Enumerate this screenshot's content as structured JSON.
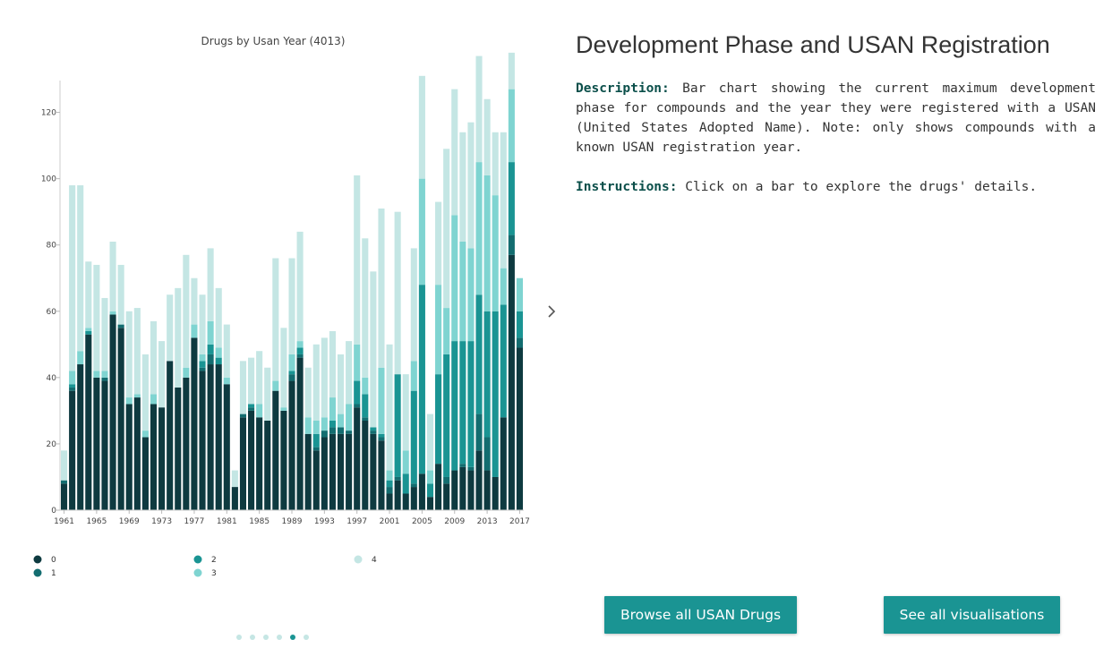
{
  "chart_data": {
    "type": "bar",
    "stacked": true,
    "title": "Drugs by Usan Year (4013)",
    "xlabel": "",
    "ylabel": "",
    "ylim": [
      0,
      135
    ],
    "yticks": [
      0,
      20,
      40,
      60,
      80,
      100,
      120
    ],
    "xtick_labels": [
      "1961",
      "1965",
      "1969",
      "1973",
      "1977",
      "1981",
      "1985",
      "1989",
      "1993",
      "1997",
      "2001",
      "2005",
      "2009",
      "2013",
      "2017"
    ],
    "legend_position": "bottom",
    "categories": [
      "1961",
      "1962",
      "1963",
      "1964",
      "1965",
      "1966",
      "1967",
      "1968",
      "1969",
      "1970",
      "1971",
      "1972",
      "1973",
      "1974",
      "1975",
      "1976",
      "1977",
      "1978",
      "1979",
      "1980",
      "1981",
      "1982",
      "1983",
      "1984",
      "1985",
      "1986",
      "1987",
      "1988",
      "1989",
      "1990",
      "1991",
      "1992",
      "1993",
      "1994",
      "1995",
      "1996",
      "1997",
      "1998",
      "1999",
      "2000",
      "2001",
      "2002",
      "2003",
      "2004",
      "2005",
      "2006",
      "2007",
      "2008",
      "2009",
      "2010",
      "2011",
      "2012",
      "2013",
      "2014",
      "2015",
      "2016",
      "2017"
    ],
    "series": [
      {
        "name": "0",
        "color": "#0e3a40",
        "values": [
          8,
          36,
          44,
          53,
          40,
          39,
          59,
          55,
          32,
          34,
          22,
          32,
          31,
          45,
          37,
          40,
          52,
          42,
          44,
          44,
          38,
          7,
          28,
          30,
          28,
          27,
          36,
          30,
          39,
          46,
          23,
          18,
          22,
          23,
          23,
          23,
          31,
          27,
          23,
          21,
          5,
          9,
          5,
          7,
          11,
          4,
          14,
          8,
          12,
          13,
          12,
          18,
          12,
          10,
          28,
          77,
          49
        ]
      },
      {
        "name": "1",
        "color": "#136d70",
        "values": [
          1,
          1,
          0,
          0,
          0,
          1,
          0,
          1,
          0,
          0,
          0,
          0,
          0,
          0,
          0,
          0,
          0,
          1,
          3,
          0,
          0,
          0,
          1,
          1,
          0,
          0,
          0,
          0,
          2,
          1,
          0,
          1,
          2,
          2,
          2,
          1,
          1,
          1,
          1,
          1,
          2,
          1,
          0,
          1,
          0,
          0,
          0,
          2,
          0,
          1,
          1,
          11,
          10,
          0,
          0,
          6,
          3
        ]
      },
      {
        "name": "2",
        "color": "#1a9493",
        "values": [
          0,
          1,
          0,
          1,
          0,
          0,
          0,
          0,
          0,
          0,
          0,
          0,
          0,
          0,
          0,
          0,
          0,
          2,
          3,
          2,
          0,
          0,
          0,
          1,
          0,
          0,
          0,
          0,
          1,
          2,
          0,
          4,
          0,
          2,
          0,
          0,
          7,
          7,
          1,
          1,
          2,
          31,
          6,
          28,
          57,
          4,
          27,
          37,
          39,
          37,
          38,
          36,
          38,
          50,
          34,
          22,
          8
        ]
      },
      {
        "name": "3",
        "color": "#7fd4d1",
        "values": [
          0,
          4,
          4,
          1,
          2,
          2,
          1,
          0,
          2,
          1,
          2,
          3,
          0,
          0,
          0,
          3,
          4,
          2,
          7,
          3,
          2,
          0,
          0,
          0,
          4,
          0,
          3,
          1,
          5,
          2,
          5,
          4,
          4,
          7,
          4,
          8,
          11,
          5,
          0,
          20,
          3,
          0,
          7,
          9,
          32,
          4,
          27,
          14,
          38,
          30,
          28,
          40,
          41,
          35,
          11,
          22,
          10
        ]
      },
      {
        "name": "4",
        "color": "#c4e6e4",
        "values": [
          9,
          56,
          50,
          20,
          32,
          22,
          21,
          18,
          26,
          26,
          23,
          22,
          20,
          20,
          30,
          34,
          14,
          18,
          22,
          18,
          16,
          5,
          16,
          14,
          16,
          16,
          37,
          24,
          29,
          33,
          15,
          23,
          24,
          20,
          18,
          19,
          51,
          42,
          47,
          48,
          38,
          49,
          23,
          34,
          31,
          17,
          25,
          48,
          38,
          33,
          38,
          32,
          23,
          19,
          41,
          11,
          0
        ]
      }
    ]
  },
  "panel": {
    "title": "Development Phase and USAN Registration",
    "description_label": "Description:",
    "description_text": " Bar chart showing the current maximum development phase for compounds and the year they were registered with a USAN (United States Adopted Name). Note: only shows compounds with a known USAN registration year.",
    "instructions_label": "Instructions:",
    "instructions_text": " Click on a bar to explore the drugs' details."
  },
  "buttons": {
    "browse_label": "Browse all USAN Drugs",
    "all_label": "See all visualisations"
  },
  "carousel": {
    "total_dots": 6,
    "active_index": 4
  },
  "colors": {
    "accent": "#1a9493",
    "dark_text": "#0b4f4a"
  },
  "icons": {
    "next": "chevron-right-icon"
  }
}
